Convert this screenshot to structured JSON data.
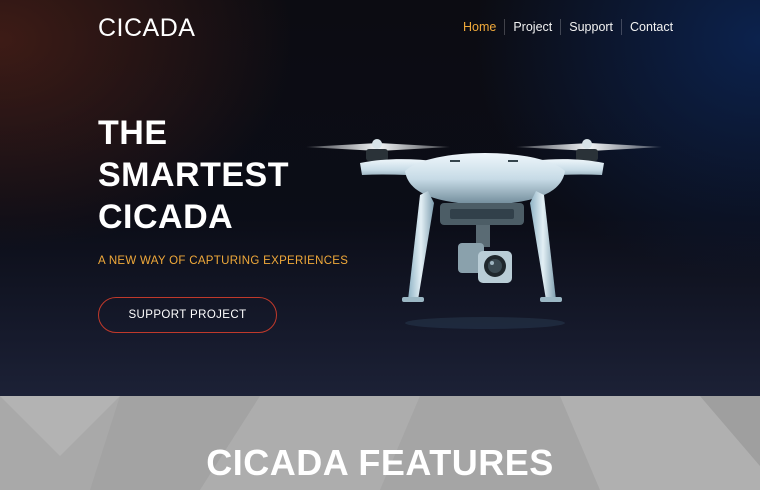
{
  "brand": {
    "logo": "CICADA"
  },
  "nav": {
    "items": [
      {
        "label": "Home",
        "active": true
      },
      {
        "label": "Project",
        "active": false
      },
      {
        "label": "Support",
        "active": false
      },
      {
        "label": "Contact",
        "active": false
      }
    ]
  },
  "hero": {
    "headline_lines": [
      "THE",
      "SMARTEST",
      "CICADA"
    ],
    "tagline": "A NEW WAY OF CAPTURING EXPERIENCES",
    "cta_label": "SUPPORT PROJECT",
    "image": "drone"
  },
  "features": {
    "title": "CICADA FEATURES"
  },
  "colors": {
    "accent": "#f0a93a",
    "cta_border": "#c0392b",
    "features_bg": "#a9a9a9"
  }
}
